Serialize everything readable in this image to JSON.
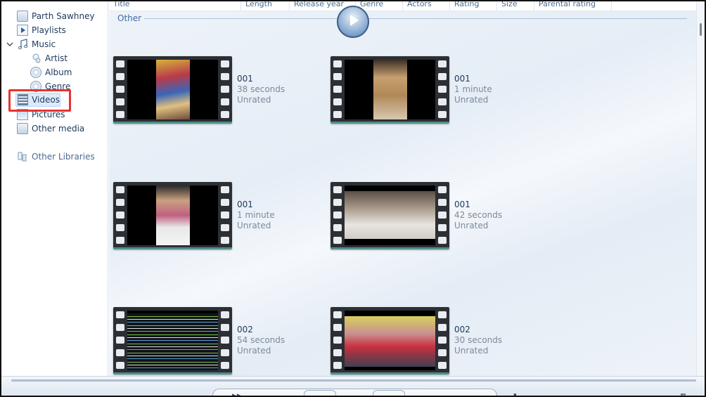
{
  "sidebar": {
    "items": [
      {
        "label": "Parth Sawhney",
        "icon": "library-icon"
      },
      {
        "label": "Playlists",
        "icon": "playlist-icon"
      },
      {
        "label": "Music",
        "icon": "music-note-icon"
      },
      {
        "label": "Artist",
        "icon": "artist-icon"
      },
      {
        "label": "Album",
        "icon": "album-icon"
      },
      {
        "label": "Genre",
        "icon": "genre-icon"
      },
      {
        "label": "Videos",
        "icon": "video-icon"
      },
      {
        "label": "Pictures",
        "icon": "pictures-icon"
      },
      {
        "label": "Other media",
        "icon": "other-media-icon"
      },
      {
        "label": "Other Libraries",
        "icon": "other-libraries-icon"
      }
    ],
    "selected": "Videos"
  },
  "columns": [
    "Title",
    "Length",
    "Release year",
    "Genre",
    "Actors",
    "Rating",
    "Size",
    "Parental rating"
  ],
  "group": {
    "label": "Other"
  },
  "videos": [
    {
      "title": "001",
      "length": "38 seconds",
      "rating": "Unrated"
    },
    {
      "title": "001",
      "length": "1 minute",
      "rating": "Unrated"
    },
    {
      "title": "001",
      "length": "1 minute",
      "rating": "Unrated"
    },
    {
      "title": "001",
      "length": "42 seconds",
      "rating": "Unrated"
    },
    {
      "title": "002",
      "length": "54 seconds",
      "rating": "Unrated"
    },
    {
      "title": "002",
      "length": "30 seconds",
      "rating": "Unrated"
    }
  ],
  "colors": {
    "accent": "#3d6aa3",
    "highlight": "#e8332f",
    "selection": "#dcebfc"
  }
}
